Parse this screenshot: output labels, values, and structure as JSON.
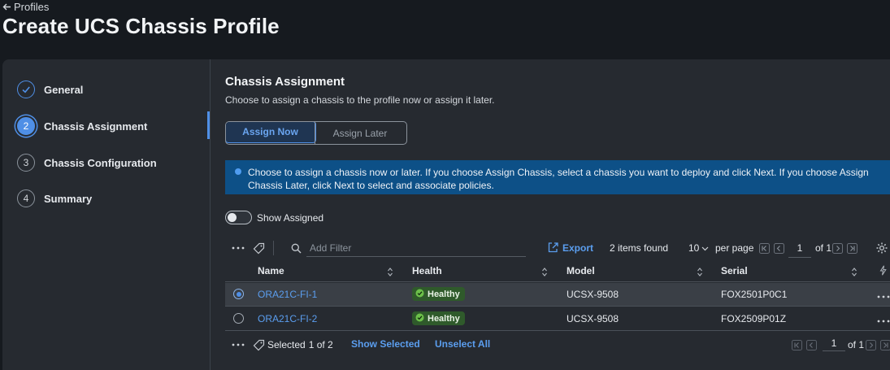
{
  "header": {
    "back_label": "Profiles",
    "title": "Create UCS Chassis Profile"
  },
  "steps": [
    {
      "num": "",
      "label": "General",
      "state": "done"
    },
    {
      "num": "2",
      "label": "Chassis Assignment",
      "state": "active"
    },
    {
      "num": "3",
      "label": "Chassis Configuration",
      "state": "todo"
    },
    {
      "num": "4",
      "label": "Summary",
      "state": "todo"
    }
  ],
  "main": {
    "title": "Chassis Assignment",
    "description": "Choose to assign a chassis to the profile now or assign it later.",
    "assign_now": "Assign Now",
    "assign_later": "Assign Later",
    "banner": "Choose to assign a chassis now or later. If you choose Assign Chassis, select a chassis you want to deploy and click Next. If you choose Assign Chassis Later, click Next to select and associate policies.",
    "show_assigned": "Show Assigned"
  },
  "toolbar": {
    "filter_placeholder": "Add Filter",
    "export": "Export",
    "items_found": "2 items found",
    "per_page_value": "10",
    "per_page_label": "per page",
    "page": "1",
    "of_pages": "of 1"
  },
  "table": {
    "columns": [
      "Name",
      "Health",
      "Model",
      "Serial"
    ],
    "rows": [
      {
        "name": "ORA21C-FI-1",
        "health": "Healthy",
        "model": "UCSX-9508",
        "serial": "FOX2501P0C1",
        "selected": true
      },
      {
        "name": "ORA21C-FI-2",
        "health": "Healthy",
        "model": "UCSX-9508",
        "serial": "FOX2509P01Z",
        "selected": false
      }
    ]
  },
  "footer": {
    "selected_prefix": "Selected",
    "selected_count": "1 of 2",
    "show_selected": "Show Selected",
    "unselect_all": "Unselect All",
    "page": "1",
    "of_pages": "of 1"
  },
  "colors": {
    "accent": "#4f8fe6",
    "link": "#5b9eef",
    "banner": "#0d5087",
    "healthy": "#2f5a2b"
  }
}
